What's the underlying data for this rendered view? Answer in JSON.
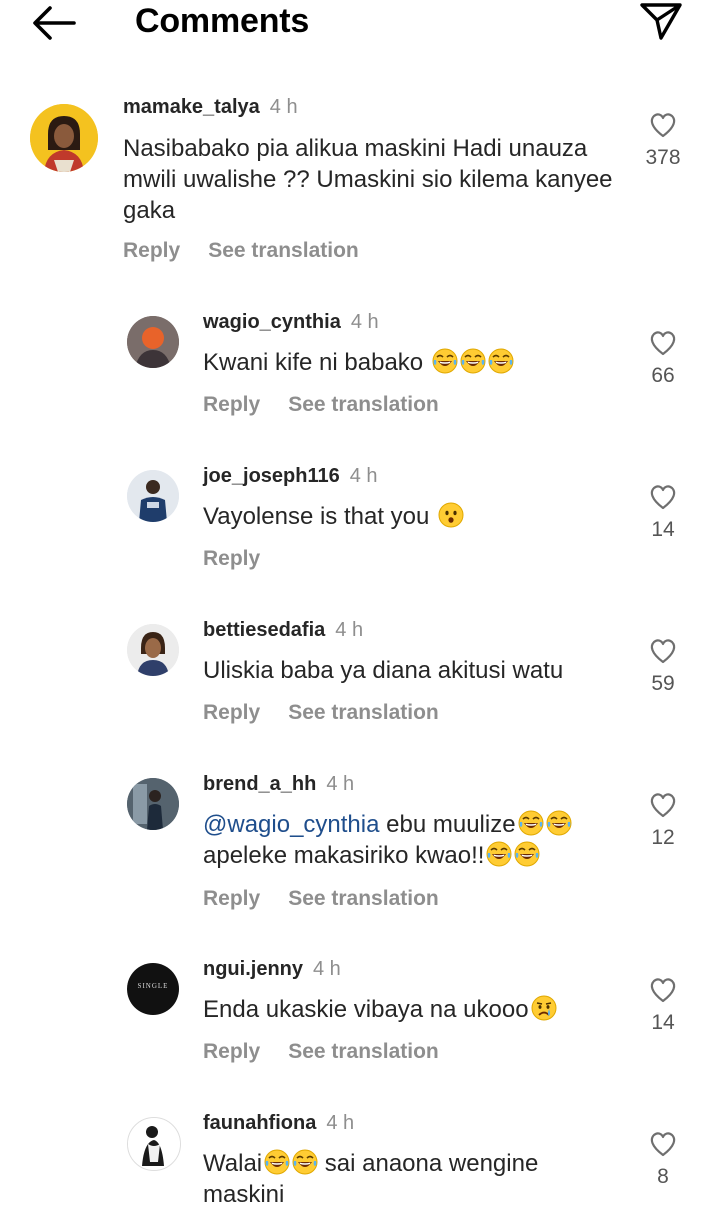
{
  "header": {
    "title": "Comments",
    "back_icon": "arrow-left-icon",
    "share_icon": "send-icon"
  },
  "actions": {
    "reply": "Reply",
    "translate": "See translation"
  },
  "comments": [
    {
      "username": "mamake_talya",
      "time": "4 h",
      "text": "Nasibabako pia alikua maskini Hadi unauza mwili uwalishe ?? Umaskini sio kilema kanyee gaka",
      "likes": "378",
      "show_translation": true,
      "reply_level": 0
    },
    {
      "username": "wagio_cynthia",
      "time": "4 h",
      "text_before": "Kwani kife ni babako ",
      "emoji": "laughing-tears-emoji",
      "likes": "66",
      "show_translation": true,
      "reply_level": 1
    },
    {
      "username": "joe_joseph116",
      "time": "4 h",
      "text_before": "Vayolense is that you ",
      "emoji": "hushed-face-emoji",
      "likes": "14",
      "show_translation": false,
      "reply_level": 1
    },
    {
      "username": "bettiesedafia",
      "time": "4 h",
      "text": "Uliskia baba ya diana akitusi watu",
      "likes": "59",
      "show_translation": true,
      "reply_level": 1
    },
    {
      "username": "brend_a_hh",
      "time": "4 h",
      "mention": "@wagio_cynthia",
      "line1": " ebu muulize",
      "line2": "apeleke makasiriko kwao!!",
      "likes": "12",
      "show_translation": true,
      "reply_level": 1
    },
    {
      "username": "ngui.jenny",
      "time": "4 h",
      "text_before": "Enda ukaskie vibaya na ukooo",
      "emoji": "crying-face-emoji",
      "avatar_text": "SINGLE",
      "likes": "14",
      "show_translation": true,
      "reply_level": 1
    },
    {
      "username": "faunahfiona",
      "time": "4 h",
      "line1": "Walai",
      "line1_after": " sai anaona wengine",
      "line2": "maskini",
      "likes": "8",
      "show_translation": false,
      "reply_level": 1
    }
  ]
}
